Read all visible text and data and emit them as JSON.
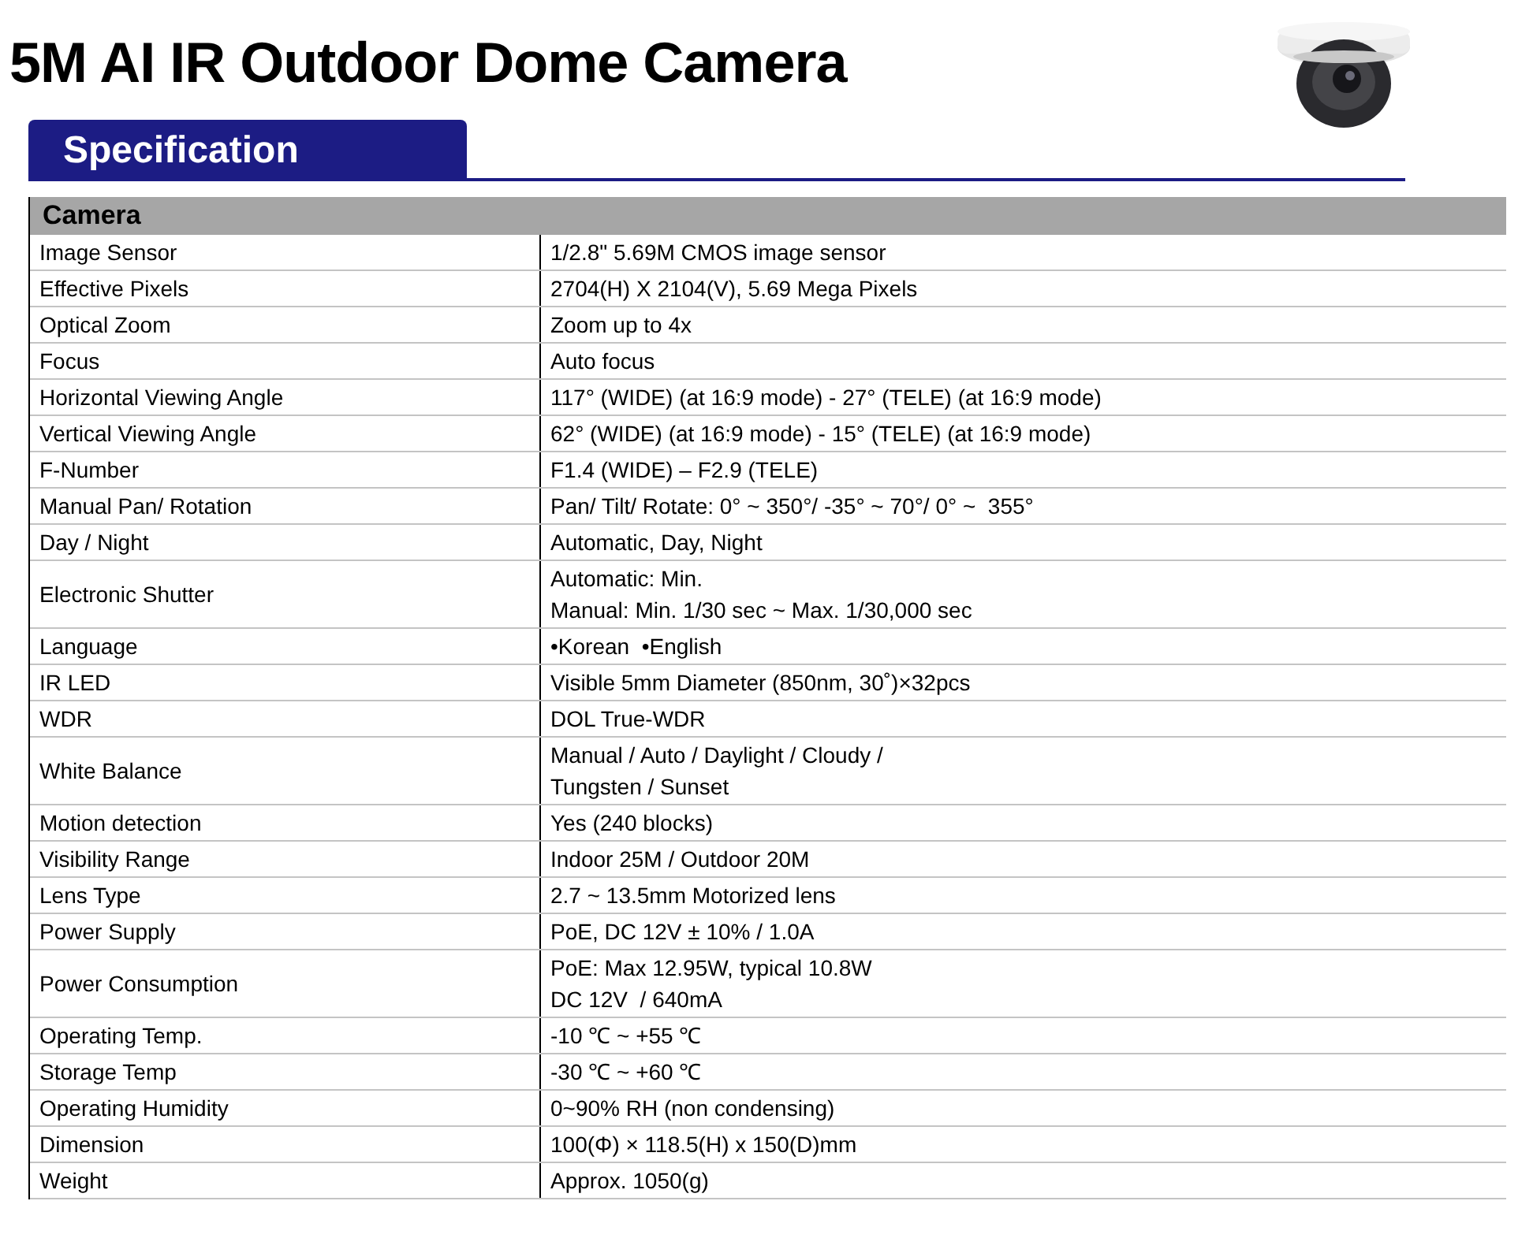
{
  "title": "5M AI IR Outdoor Dome Camera",
  "section_tab": "Specification",
  "table": {
    "group": "Camera",
    "rows": [
      {
        "label": "Image Sensor",
        "value": [
          "1/2.8\" 5.69M CMOS image sensor"
        ]
      },
      {
        "label": "Effective Pixels",
        "value": [
          "2704(H) X 2104(V), 5.69 Mega Pixels"
        ]
      },
      {
        "label": "Optical Zoom",
        "value": [
          "Zoom up to 4x"
        ]
      },
      {
        "label": "Focus",
        "value": [
          "Auto focus"
        ]
      },
      {
        "label": "Horizontal Viewing Angle",
        "value": [
          "117° (WIDE) (at 16:9 mode) - 27° (TELE) (at 16:9 mode)"
        ]
      },
      {
        "label": "Vertical Viewing Angle",
        "value": [
          "62° (WIDE) (at 16:9 mode) - 15° (TELE) (at 16:9 mode)"
        ]
      },
      {
        "label": "F-Number",
        "value": [
          "F1.4 (WIDE) – F2.9 (TELE)"
        ]
      },
      {
        "label": "Manual Pan/ Rotation",
        "value": [
          "Pan/ Tilt/ Rotate: 0° ~ 350°/ -35° ~ 70°/ 0° ~  355°"
        ]
      },
      {
        "label": "Day / Night",
        "value": [
          "Automatic, Day, Night"
        ]
      },
      {
        "label": "Electronic Shutter",
        "value": [
          "Automatic: Min.",
          "Manual: Min. 1/30 sec ~ Max. 1/30,000 sec"
        ]
      },
      {
        "label": "Language",
        "value": [
          "•Korean  •English"
        ]
      },
      {
        "label": "IR LED",
        "value": [
          "Visible 5mm Diameter (850nm, 30˚)×32pcs"
        ]
      },
      {
        "label": "WDR",
        "value": [
          "DOL True-WDR"
        ]
      },
      {
        "label": "White Balance",
        "value": [
          "Manual / Auto / Daylight / Cloudy /",
          "Tungsten / Sunset"
        ]
      },
      {
        "label": "Motion detection",
        "value": [
          "Yes (240 blocks)"
        ]
      },
      {
        "label": "Visibility Range",
        "value": [
          "Indoor 25M / Outdoor 20M"
        ]
      },
      {
        "label": "Lens Type",
        "value": [
          "2.7 ~ 13.5mm Motorized lens"
        ]
      },
      {
        "label": "Power Supply",
        "value": [
          "PoE, DC 12V ± 10% / 1.0A"
        ]
      },
      {
        "label": "Power Consumption",
        "value": [
          "PoE: Max 12.95W, typical 10.8W",
          "DC 12V  / 640mA"
        ]
      },
      {
        "label": "Operating Temp.",
        "value": [
          "-10 ℃ ~ +55 ℃"
        ]
      },
      {
        "label": "Storage Temp",
        "value": [
          "-30 ℃ ~ +60 ℃"
        ]
      },
      {
        "label": "Operating Humidity",
        "value": [
          "0~90% RH (non condensing)"
        ]
      },
      {
        "label": "Dimension",
        "value": [
          "100(Φ) × 118.5(H) x 150(D)mm"
        ]
      },
      {
        "label": "Weight",
        "value": [
          "Approx. 1050(g)"
        ]
      }
    ]
  }
}
